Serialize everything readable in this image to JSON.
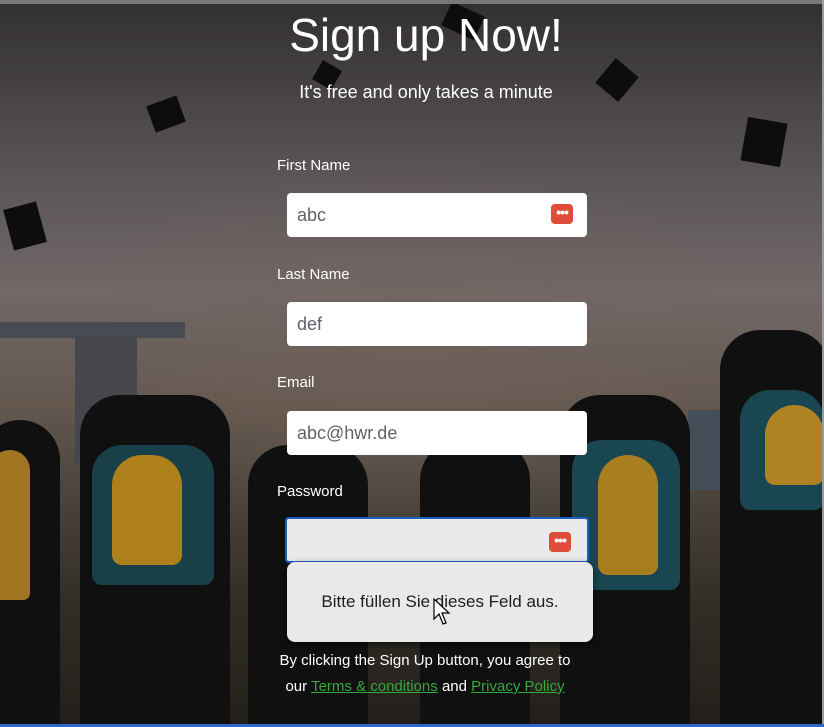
{
  "header": {
    "title": "Sign up Now!",
    "subtitle": "It's free and only takes a minute"
  },
  "form": {
    "first_name": {
      "label": "First Name",
      "value": "abc"
    },
    "last_name": {
      "label": "Last Name",
      "value": "def"
    },
    "email": {
      "label": "Email",
      "value": "abc@hwr.de"
    },
    "password": {
      "label": "Password",
      "value": ""
    },
    "password_manager_icon": "password-manager-icon"
  },
  "validation": {
    "message": "Bitte füllen Sie dieses Feld aus."
  },
  "legal": {
    "text_before": "By clicking the Sign Up button, you agree to our",
    "terms_link": "Terms & conditions",
    "conjunction": "and",
    "privacy_link": "Privacy Policy"
  },
  "colors": {
    "link": "#35a83b",
    "focus_border": "#1f5fc2",
    "icon_bg": "#e04c3a"
  }
}
